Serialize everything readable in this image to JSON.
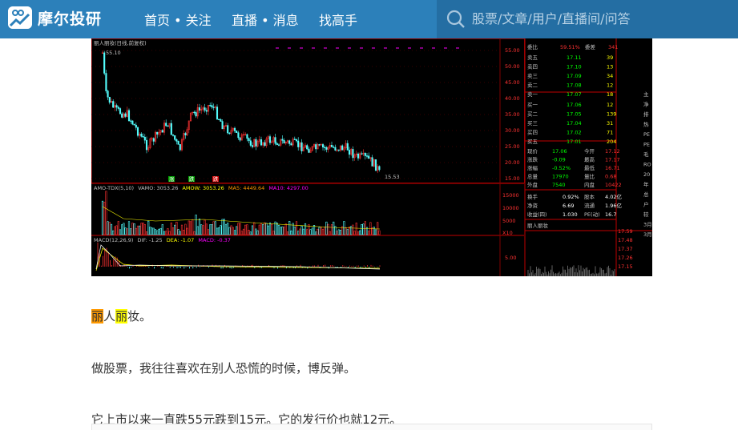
{
  "header": {
    "logo_text": "摩尔投研",
    "nav": [
      "首页 • 关注",
      "直播 • 消息",
      "找高手"
    ],
    "search_placeholder": "股票/文章/用户/直播间/问答"
  },
  "kline": {
    "title": "丽人丽妆(日线,前复权)",
    "high_label": "55.10",
    "low_label": "15.53",
    "price_ticks": [
      "55.00",
      "50.00",
      "45.00",
      "40.00",
      "35.00",
      "30.00",
      "25.00",
      "20.00",
      "15.00"
    ],
    "event_marks": [
      "涨",
      "跌",
      "跌"
    ],
    "vol_header": [
      "AMO-TDX(5,10)",
      "VAMO: 3053.26",
      "AMOW: 3053.26",
      "MA5: 4449.64",
      "MA10: 4297.00"
    ],
    "vol_ticks": [
      "15000",
      "10000",
      "5000",
      "X10"
    ],
    "macd_header": [
      "MACD(12,26,9)",
      "DIF: -1.25",
      "DEA: -1.07",
      "MACD: -0.37"
    ],
    "macd_tick": "5.00"
  },
  "orderbook": {
    "ratio": {
      "label": "委比",
      "value": "59.51%",
      "label2": "委差",
      "value2": "341"
    },
    "asks": [
      {
        "label": "卖五",
        "price": "17.11",
        "vol": "39"
      },
      {
        "label": "卖四",
        "price": "17.10",
        "vol": "13"
      },
      {
        "label": "卖三",
        "price": "17.09",
        "vol": "34"
      },
      {
        "label": "卖二",
        "price": "17.08",
        "vol": "12"
      },
      {
        "label": "卖一",
        "price": "17.07",
        "vol": "18"
      }
    ],
    "bids": [
      {
        "label": "买一",
        "price": "17.06",
        "vol": "12"
      },
      {
        "label": "买二",
        "price": "17.05",
        "vol": "139"
      },
      {
        "label": "买三",
        "price": "17.04",
        "vol": "31"
      },
      {
        "label": "买四",
        "price": "17.02",
        "vol": "71"
      },
      {
        "label": "买五",
        "price": "17.01",
        "vol": "204"
      }
    ],
    "stats": [
      {
        "l1": "现价",
        "v1": "17.06",
        "l2": "今开",
        "v2": "17.12"
      },
      {
        "l1": "涨跌",
        "v1": "-0.09",
        "l2": "最高",
        "v2": "17.17"
      },
      {
        "l1": "涨幅",
        "v1": "-0.52%",
        "l2": "最低",
        "v2": "16.71"
      },
      {
        "l1": "总量",
        "v1": "17970",
        "l2": "量比",
        "v2": "0.68"
      },
      {
        "l1": "外盘",
        "v1": "7540",
        "l2": "内盘",
        "v2": "10422"
      }
    ],
    "stats2": [
      {
        "l1": "换手",
        "v1": "0.92%",
        "l2": "股本",
        "v2": "4.02亿"
      },
      {
        "l1": "净资",
        "v1": "6.69",
        "l2": "流通",
        "v2": "1.96亿"
      },
      {
        "l1": "收益(四)",
        "v1": "1.030",
        "l2": "PE(动)",
        "v2": "16.7"
      }
    ],
    "mini_title": "丽人丽妆",
    "mini_ticks": [
      "17.59",
      "17.48",
      "17.37",
      "17.26",
      "17.15"
    ],
    "side_labels": [
      "主",
      "净",
      "排",
      "热",
      "PE",
      "PE",
      "毛",
      "RO",
      "20",
      "年",
      "总",
      "户",
      "较",
      "3月",
      "3月"
    ]
  },
  "article": {
    "p1_hl1": "丽",
    "p1_mid": "人",
    "p1_hl2": "丽",
    "p1_end": "妆。",
    "p2": "做股票，我往往喜欢在别人恐慌的时候，博反弹。",
    "p3": "它上市以来一直跌55元跌到15元。它的发行价也就12元。"
  },
  "colors": {
    "header_bg": "#2c80ba",
    "search_bg": "#246ea3",
    "up": "#ff3232",
    "down": "#54ffff",
    "price": "#ffff00"
  }
}
